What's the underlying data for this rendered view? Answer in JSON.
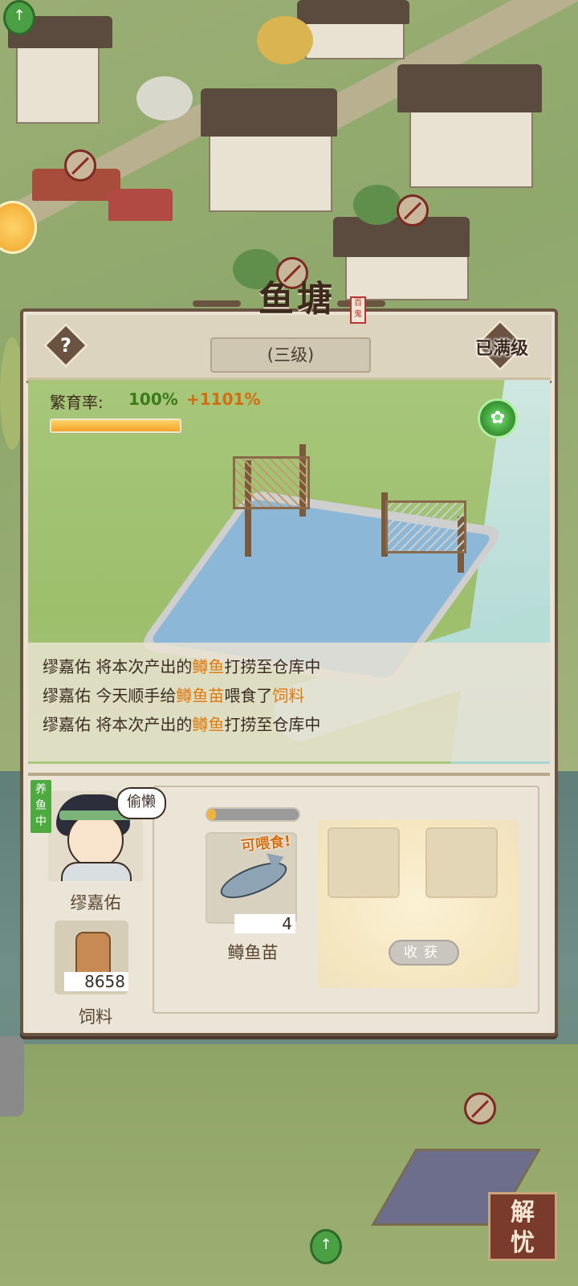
{
  "building": {
    "title": "鱼塘",
    "level": "(三级)",
    "max_level_label": "已满级",
    "help_icon": "?",
    "seal_text": "百鬼"
  },
  "breeding": {
    "label": "繁育率:",
    "rate": "100%",
    "bonus": "+1101%",
    "progress": 1.0
  },
  "logs": [
    {
      "actor": "缪嘉佑",
      "pre": " 将本次产出的",
      "item": "鳟鱼",
      "post": "打捞至仓库中",
      "item2": "",
      "post2": ""
    },
    {
      "actor": "缪嘉佑",
      "pre": " 今天顺手给",
      "item": "鳟鱼苗",
      "post": "喂食了",
      "item2": "饲料",
      "post2": ""
    },
    {
      "actor": "缪嘉佑",
      "pre": " 将本次产出的",
      "item": "鳟鱼",
      "post": "打捞至仓库中",
      "item2": "",
      "post2": ""
    }
  ],
  "worker": {
    "status": "养鱼中",
    "thought": "偷懒",
    "name": "缪嘉佑"
  },
  "feed": {
    "count": "8658",
    "name": "饲料"
  },
  "fry": {
    "feedable_label": "可喂食!",
    "count": "4",
    "name": "鳟鱼苗",
    "progress": 0.1
  },
  "harvest": {
    "button_label": "收获"
  },
  "corner_button": {
    "label_line1": "解",
    "label_line2": "忧"
  },
  "colors": {
    "accent_orange": "#e07a10",
    "rate_green": "#3c7a1c",
    "frame_brown": "#6a5340"
  }
}
